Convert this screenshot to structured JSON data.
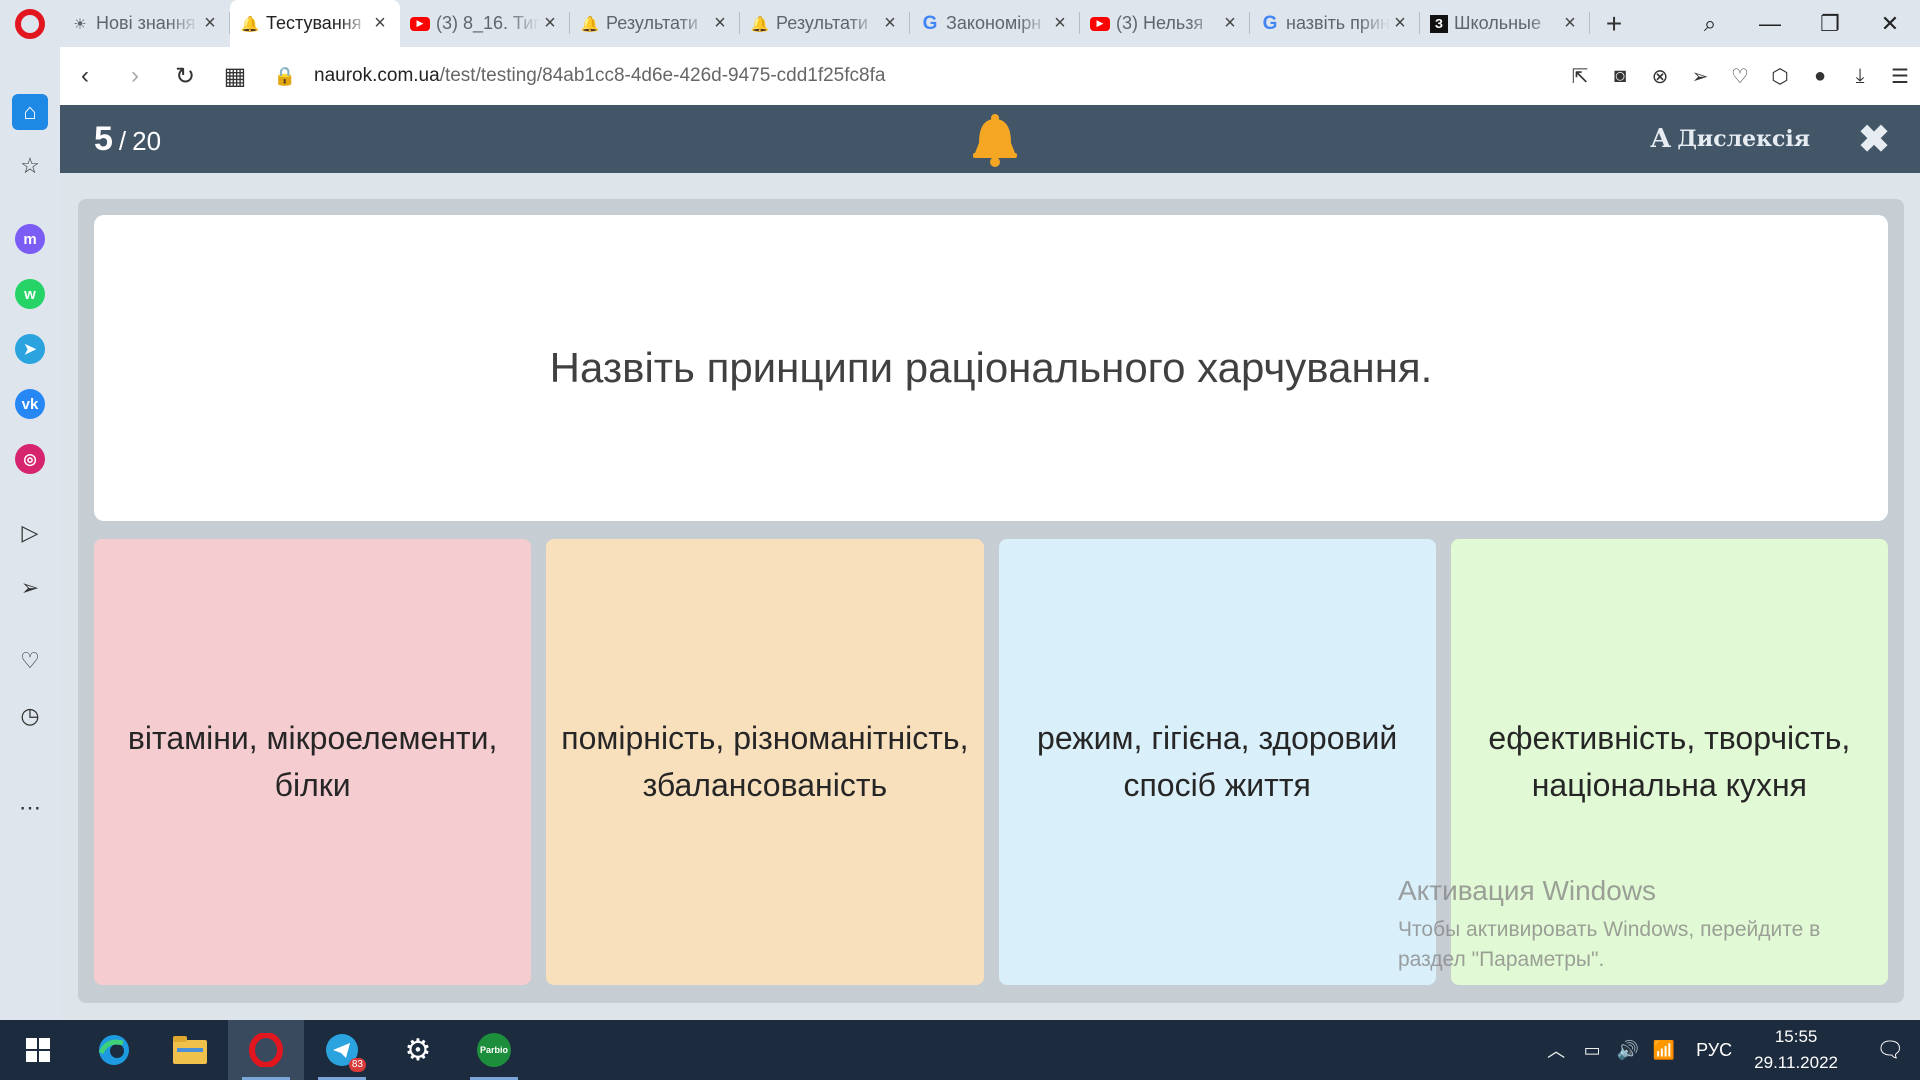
{
  "tabs": [
    {
      "title": "Нові знання",
      "icon": "sun-icon",
      "active": false
    },
    {
      "title": "Тестування",
      "icon": "naurok-bell-icon",
      "active": true
    },
    {
      "title": "(3) 8_16. Тип",
      "icon": "youtube-icon",
      "active": false
    },
    {
      "title": "Результати",
      "icon": "naurok-bell-icon",
      "active": false
    },
    {
      "title": "Результати",
      "icon": "naurok-bell-icon",
      "active": false
    },
    {
      "title": "Закономірн",
      "icon": "google-icon",
      "active": false
    },
    {
      "title": "(3) Нельзя",
      "icon": "youtube-icon",
      "active": false
    },
    {
      "title": "назвіть прин",
      "icon": "google-icon",
      "active": false
    },
    {
      "title": "Школьные",
      "icon": "znanija-icon",
      "active": false
    }
  ],
  "address": {
    "domain": "naurok.com.ua",
    "path": "/test/testing/84ab1cc8-4d6e-426d-9475-cdd1f25fc8fa"
  },
  "test": {
    "current": "5",
    "separator": "/",
    "total": "20",
    "dyslexia_icon": "А",
    "dyslexia_label": "Дислексія",
    "question": "Назвіть принципи раціонального харчування.",
    "answers": [
      {
        "text": "вітаміни, мікроелементи, білки",
        "color": "#f5cdd0"
      },
      {
        "text": "помірність, різноманітність, збалансованість",
        "color": "#f9e0bd"
      },
      {
        "text": "режим, гігієна, здоровий спосіб життя",
        "color": "#d9eff9"
      },
      {
        "text": "ефективність, творчість, національна кухня",
        "color": "#e1f9d4"
      }
    ]
  },
  "watermark": {
    "title": "Активация Windows",
    "line1": "Чтобы активировать Windows, перейдите в",
    "line2": "раздел \"Параметры\"."
  },
  "taskbar": {
    "telegram_badge": "83",
    "app_label": "Parbio",
    "lang": "РУС",
    "time": "15:55",
    "date": "29.11.2022"
  },
  "colors": {
    "topbar": "#435667",
    "bell": "#f5a623",
    "opera_red": "#e2161e",
    "sidebar_home": "#1e88e5"
  }
}
